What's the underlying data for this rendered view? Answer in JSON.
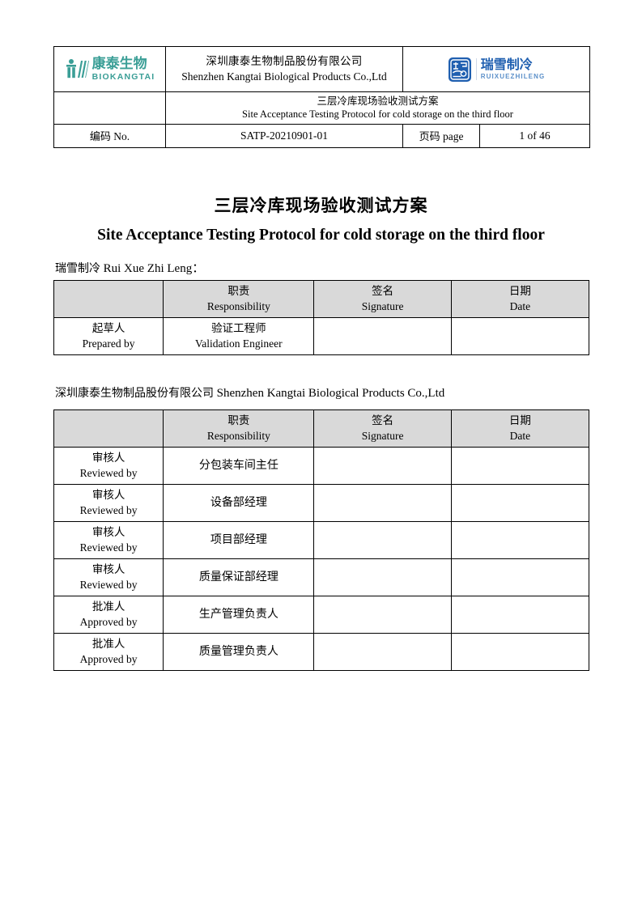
{
  "header": {
    "left_logo": {
      "icon": "kangtai-figure-icon",
      "chinese": "康泰生物",
      "english": "BIOKANGTAI",
      "color": "#3a9e96"
    },
    "right_logo": {
      "icon": "ruixue-seal-icon",
      "chinese": "瑞雪制冷",
      "english": "RUIXUEZHILENG",
      "color": "#1f5fb0"
    },
    "company_cn": "深圳康泰生物制品股份有限公司",
    "company_en": "Shenzhen Kangtai Biological Products Co.,Ltd",
    "doc_title_cn": "三层冷库现场验收测试方案",
    "doc_title_en": "Site Acceptance Testing Protocol for cold storage on the third floor",
    "no_label_cn": "编码",
    "no_label_en": "No.",
    "no_value": "SATP-20210901-01",
    "page_label_cn": "页码",
    "page_label_en": "page",
    "page_value": "1 of 46"
  },
  "body": {
    "main_title_cn": "三层冷库现场验收测试方案",
    "main_title_en": "Site Acceptance Testing Protocol for cold storage on the third floor",
    "party1_cn": "瑞雪制冷",
    "party1_en": "Rui Xue Zhi Leng：",
    "party2_cn": "深圳康泰生物制品股份有限公司",
    "party2_en": "Shenzhen Kangtai Biological Products Co.,Ltd"
  },
  "table_headers": {
    "col1_cn": "",
    "col1_en": "",
    "col2_cn": "职责",
    "col2_en": "Responsibility",
    "col3_cn": "签名",
    "col3_en": "Signature",
    "col4_cn": "日期",
    "col4_en": "Date"
  },
  "table1_rows": [
    {
      "role_cn": "起草人",
      "role_en": "Prepared by",
      "responsibility_cn": "验证工程师",
      "responsibility_en": "Validation Engineer",
      "signature": "",
      "date": ""
    }
  ],
  "table2_rows": [
    {
      "role_cn": "审核人",
      "role_en": "Reviewed by",
      "responsibility_cn": "分包装车间主任",
      "responsibility_en": "",
      "signature": "",
      "date": ""
    },
    {
      "role_cn": "审核人",
      "role_en": "Reviewed by",
      "responsibility_cn": "设备部经理",
      "responsibility_en": "",
      "signature": "",
      "date": ""
    },
    {
      "role_cn": "审核人",
      "role_en": "Reviewed by",
      "responsibility_cn": "项目部经理",
      "responsibility_en": "",
      "signature": "",
      "date": ""
    },
    {
      "role_cn": "审核人",
      "role_en": "Reviewed by",
      "responsibility_cn": "质量保证部经理",
      "responsibility_en": "",
      "signature": "",
      "date": ""
    },
    {
      "role_cn": "批准人",
      "role_en": "Approved by",
      "responsibility_cn": "生产管理负责人",
      "responsibility_en": "",
      "signature": "",
      "date": ""
    },
    {
      "role_cn": "批准人",
      "role_en": "Approved by",
      "responsibility_cn": "质量管理负责人",
      "responsibility_en": "",
      "signature": "",
      "date": ""
    }
  ]
}
